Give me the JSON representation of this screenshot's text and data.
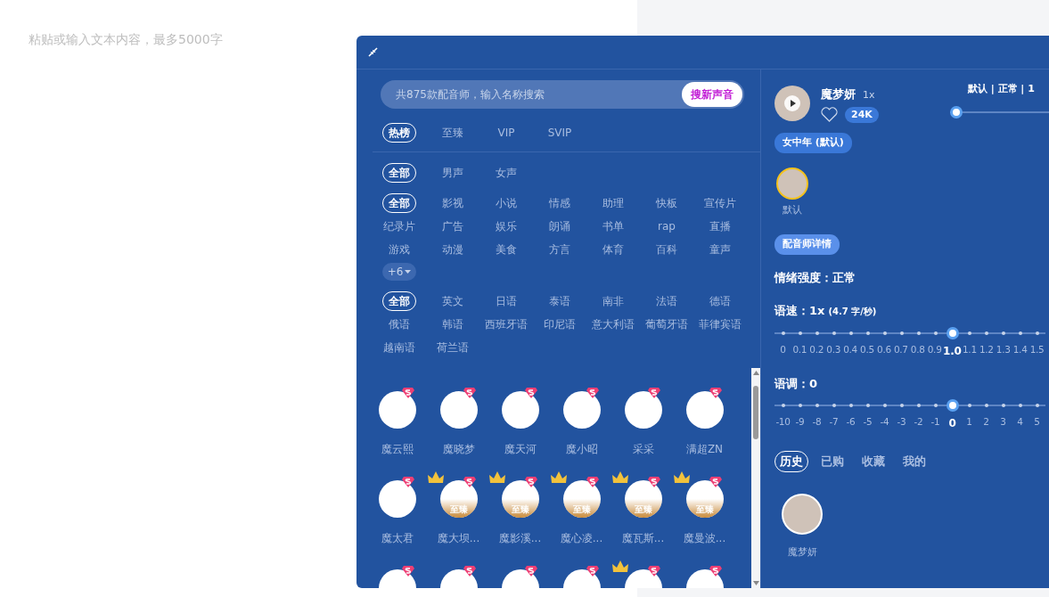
{
  "editor": {
    "placeholder": "粘贴或输入文本内容，最多5000字"
  },
  "voice_picker": {
    "search": {
      "placeholder": "共875款配音师，输入名称搜索",
      "button": "搜新声音"
    },
    "rank_tabs": [
      {
        "label": "热榜",
        "selected": true
      },
      {
        "label": "至臻",
        "selected": false
      },
      {
        "label": "VIP",
        "selected": false
      },
      {
        "label": "SVIP",
        "selected": false
      }
    ],
    "filter_groups": [
      {
        "options": [
          {
            "label": "全部",
            "selected": true
          },
          {
            "label": "男声",
            "selected": false
          },
          {
            "label": "女声",
            "selected": false
          }
        ]
      },
      {
        "options": [
          {
            "label": "全部",
            "selected": true
          },
          {
            "label": "影视",
            "selected": false
          },
          {
            "label": "小说",
            "selected": false
          },
          {
            "label": "情感",
            "selected": false
          },
          {
            "label": "助理",
            "selected": false
          },
          {
            "label": "快板",
            "selected": false
          },
          {
            "label": "宣传片",
            "selected": false
          },
          {
            "label": "纪录片",
            "selected": false
          },
          {
            "label": "广告",
            "selected": false
          },
          {
            "label": "娱乐",
            "selected": false
          },
          {
            "label": "朗诵",
            "selected": false
          },
          {
            "label": "书单",
            "selected": false
          },
          {
            "label": "rap",
            "selected": false
          },
          {
            "label": "直播",
            "selected": false
          },
          {
            "label": "游戏",
            "selected": false
          },
          {
            "label": "动漫",
            "selected": false
          },
          {
            "label": "美食",
            "selected": false
          },
          {
            "label": "方言",
            "selected": false
          },
          {
            "label": "体育",
            "selected": false
          },
          {
            "label": "百科",
            "selected": false
          },
          {
            "label": "童声",
            "selected": false
          }
        ],
        "more": "+6"
      },
      {
        "options": [
          {
            "label": "全部",
            "selected": true
          },
          {
            "label": "英文",
            "selected": false
          },
          {
            "label": "日语",
            "selected": false
          },
          {
            "label": "泰语",
            "selected": false
          },
          {
            "label": "南非",
            "selected": false
          },
          {
            "label": "法语",
            "selected": false
          },
          {
            "label": "德语",
            "selected": false
          },
          {
            "label": "俄语",
            "selected": false
          },
          {
            "label": "韩语",
            "selected": false
          },
          {
            "label": "西班牙语",
            "selected": false
          },
          {
            "label": "印尼语",
            "selected": false
          },
          {
            "label": "意大利语",
            "selected": false
          },
          {
            "label": "葡萄牙语",
            "selected": false
          },
          {
            "label": "菲律宾语",
            "selected": false
          },
          {
            "label": "越南语",
            "selected": false
          },
          {
            "label": "荷兰语",
            "selected": false
          }
        ]
      }
    ],
    "voices": [
      {
        "name": "魔云熙",
        "crown": false
      },
      {
        "name": "魔晓梦",
        "crown": false
      },
      {
        "name": "魔天河",
        "crown": false
      },
      {
        "name": "魔小昭",
        "crown": false
      },
      {
        "name": "采采",
        "crown": false
      },
      {
        "name": "满超ZN",
        "crown": false
      },
      {
        "name": "魔太君",
        "crown": false
      },
      {
        "name": "魔大坝...",
        "crown": true,
        "tag": "至臻"
      },
      {
        "name": "魔影溪...",
        "crown": true,
        "tag": "至臻"
      },
      {
        "name": "魔心凌...",
        "crown": true,
        "tag": "至臻"
      },
      {
        "name": "魔瓦斯...",
        "crown": true,
        "tag": "至臻"
      },
      {
        "name": "魔曼波...",
        "crown": true,
        "tag": "至臻"
      },
      {
        "crown": false
      },
      {
        "crown": false
      },
      {
        "crown": false
      },
      {
        "crown": false
      },
      {
        "crown": true
      },
      {
        "crown": false
      }
    ]
  },
  "detail": {
    "name": "魔梦妍",
    "speed_badge": "1x",
    "likes": "24K",
    "summary": "默认 | 正常 | 1",
    "summary_slider": {
      "level": 0
    },
    "style_tag": "女中年 (默认)",
    "emotions": [
      {
        "label": "默认",
        "selected": true
      }
    ],
    "details_button": "配音师详情",
    "intensity": "情绪强度：正常",
    "speed": {
      "label": "语速：1x",
      "note": "(4.7 字/秒)",
      "level": 0.6667,
      "ticks": [
        {
          "label": "0",
          "selected": false
        },
        {
          "label": "0.1",
          "selected": false
        },
        {
          "label": "0.2",
          "selected": false
        },
        {
          "label": "0.3",
          "selected": false
        },
        {
          "label": "0.4",
          "selected": false
        },
        {
          "label": "0.5",
          "selected": false
        },
        {
          "label": "0.6",
          "selected": false
        },
        {
          "label": "0.7",
          "selected": false
        },
        {
          "label": "0.8",
          "selected": false
        },
        {
          "label": "0.9",
          "selected": false
        },
        {
          "label": "1.0",
          "selected": true
        },
        {
          "label": "1.1",
          "selected": false
        },
        {
          "label": "1.2",
          "selected": false
        },
        {
          "label": "1.3",
          "selected": false
        },
        {
          "label": "1.4",
          "selected": false
        },
        {
          "label": "1.5",
          "selected": false
        }
      ]
    },
    "pitch": {
      "label": "语调：0",
      "level": 0.6667,
      "ticks": [
        {
          "label": "-10",
          "selected": false
        },
        {
          "label": "-9",
          "selected": false
        },
        {
          "label": "-8",
          "selected": false
        },
        {
          "label": "-7",
          "selected": false
        },
        {
          "label": "-6",
          "selected": false
        },
        {
          "label": "-5",
          "selected": false
        },
        {
          "label": "-4",
          "selected": false
        },
        {
          "label": "-3",
          "selected": false
        },
        {
          "label": "-2",
          "selected": false
        },
        {
          "label": "-1",
          "selected": false
        },
        {
          "label": "0",
          "selected": true
        },
        {
          "label": "1",
          "selected": false
        },
        {
          "label": "2",
          "selected": false
        },
        {
          "label": "3",
          "selected": false
        },
        {
          "label": "4",
          "selected": false
        },
        {
          "label": "5",
          "selected": false
        }
      ]
    },
    "history_tabs": [
      {
        "label": "历史",
        "selected": true
      },
      {
        "label": "已购",
        "selected": false
      },
      {
        "label": "收藏",
        "selected": false
      },
      {
        "label": "我的",
        "selected": false
      }
    ],
    "history": [
      {
        "name": "魔梦妍"
      }
    ]
  }
}
